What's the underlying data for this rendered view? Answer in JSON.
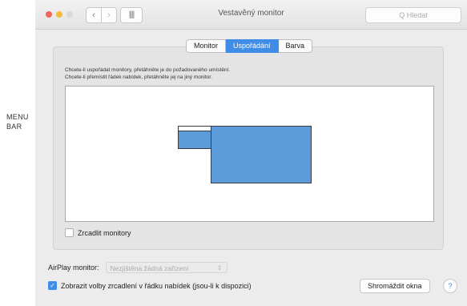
{
  "side_label": {
    "line1": "MENU",
    "line2": "BAR"
  },
  "window": {
    "title": "Vestavěný monitor",
    "search_placeholder": "Q Hledat",
    "nav": {
      "back": "‹",
      "forward": "›",
      "grid": "||||"
    }
  },
  "tabs": [
    {
      "label": "Monitor",
      "active": false
    },
    {
      "label": "Uspořádání",
      "active": true
    },
    {
      "label": "Barva",
      "active": false
    }
  ],
  "panel": {
    "instruction_line1": "Chcete-li uspořádat monitory, přetáhněte je do požadovaného umístění.",
    "instruction_line2": "Chcete-li přemístit řádek nabídek, přetáhněte jej na jiný monitor.",
    "mirror_label": "Zrcadlit monitory",
    "mirror_checked": false
  },
  "airplay": {
    "label": "AirPlay monitor:",
    "value": "Nezjištěna žádná zařízení"
  },
  "bottom": {
    "show_mirroring_label": "Zobrazit volby zrcadlení v řádku nabídek (jsou-li k dispozici)",
    "show_mirroring_checked": true,
    "gather_button": "Shromáždit okna",
    "help_button": "?"
  },
  "colors": {
    "accent": "#3f8de6",
    "monitor_fill": "#5b9bd9"
  }
}
